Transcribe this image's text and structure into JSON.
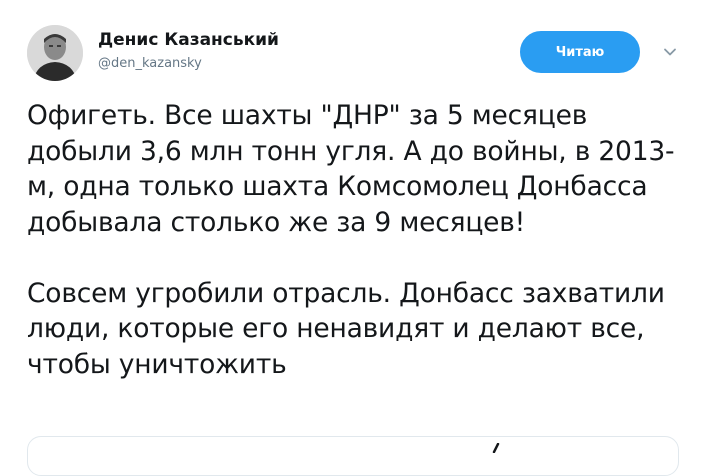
{
  "author": {
    "name": "Денис Казанський",
    "handle": "@den_kazansky"
  },
  "follow_button": {
    "label": "Читаю"
  },
  "tweet": {
    "paragraphs": [
      "Офигеть. Все шахты \"ДНР\" за 5 месяцев добыли 3,6 млн тонн угля. А до войны, в 2013-м, одна только шахта Комсомолец Донбасса добывала столько же за 9 месяцев!",
      "Совсем угробили отрасль. Донбасс захватили люди, которые его ненавидят и делают все, чтобы уничтожить"
    ]
  },
  "colors": {
    "accent": "#2a9df2",
    "text": "#14171a",
    "secondary_text": "#657786"
  },
  "icons": {
    "menu": "chevron-down-icon",
    "avatar": "avatar"
  }
}
